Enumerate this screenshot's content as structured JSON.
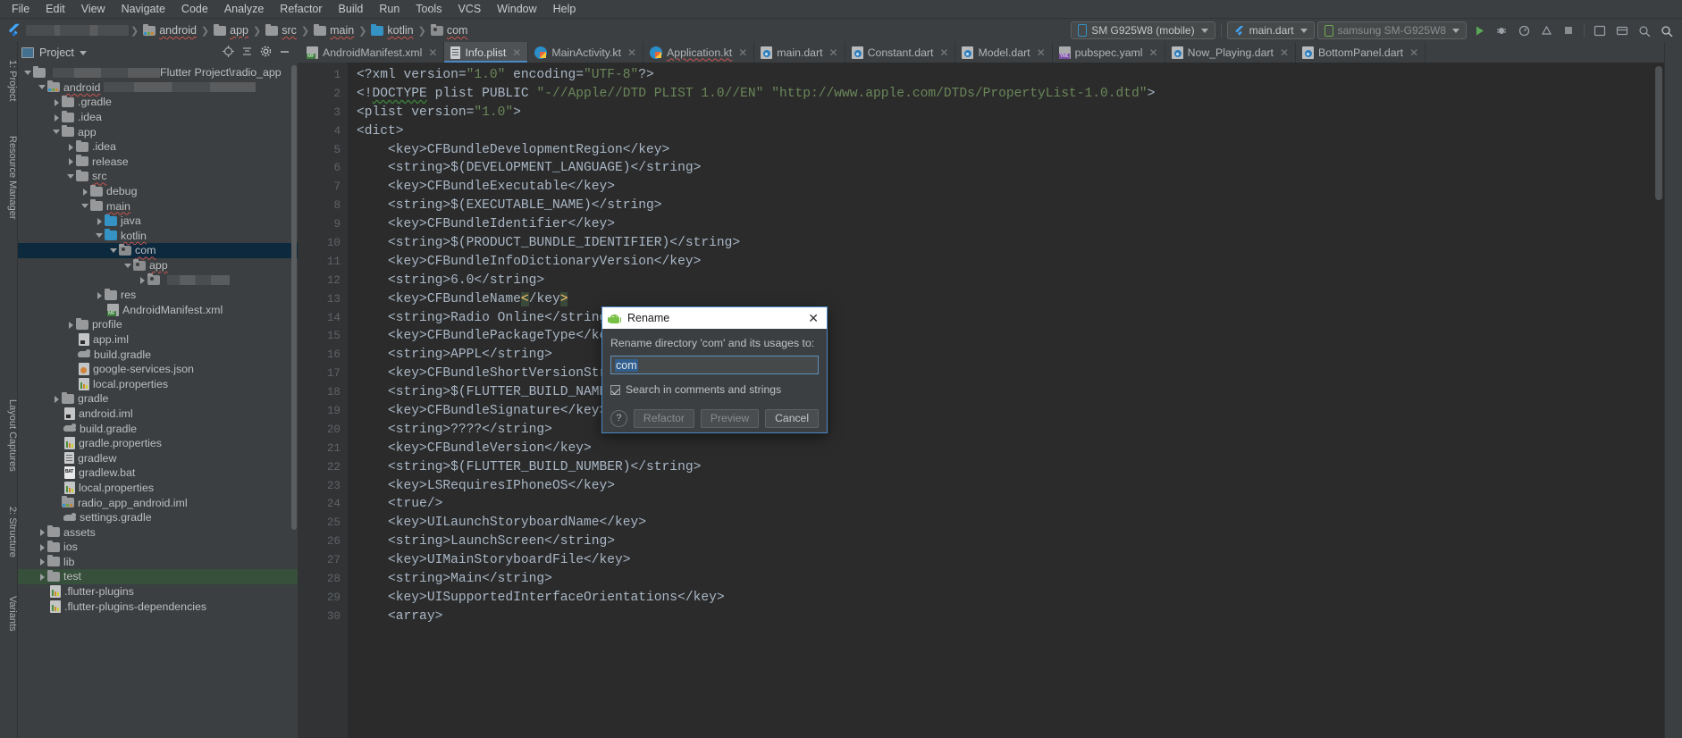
{
  "menu": {
    "items": [
      "File",
      "Edit",
      "View",
      "Navigate",
      "Code",
      "Analyze",
      "Refactor",
      "Build",
      "Run",
      "Tools",
      "VCS",
      "Window",
      "Help"
    ]
  },
  "breadcrumb": {
    "project_redacted": "",
    "items": [
      "android",
      "app",
      "src",
      "main",
      "kotlin",
      "com"
    ]
  },
  "toolbar": {
    "device": "SM G925W8 (mobile)",
    "run_config": "main.dart",
    "device2": "samsung SM-G925W8",
    "icons": [
      "run-icon",
      "debug-icon",
      "profile-icon",
      "attach-debugger-icon",
      "stop-icon",
      "avd-manager-icon",
      "sdk-manager-icon",
      "layout-inspector-icon",
      "sync-gradle-icon",
      "search-everywhere-icon"
    ]
  },
  "project_panel": {
    "title": "Project",
    "header_icons": [
      "locate-icon",
      "collapse-all-icon",
      "settings-icon",
      "hide-icon"
    ],
    "root_suffix": "Flutter Project\\radio_app",
    "tree": [
      {
        "label": "",
        "suffix": "Flutter Project\\radio_app",
        "indent": 0,
        "arrow": "d",
        "icon": "project-folder",
        "redacted": 120
      },
      {
        "label": "android",
        "indent": 1,
        "arrow": "d",
        "icon": "module-folder",
        "spell": true,
        "redacted": 170
      },
      {
        "label": ".gradle",
        "indent": 2,
        "arrow": "r",
        "icon": "folder"
      },
      {
        "label": ".idea",
        "indent": 2,
        "arrow": "r",
        "icon": "folder"
      },
      {
        "label": "app",
        "indent": 2,
        "arrow": "d",
        "icon": "folder"
      },
      {
        "label": ".idea",
        "indent": 3,
        "arrow": "r",
        "icon": "folder"
      },
      {
        "label": "release",
        "indent": 3,
        "arrow": "r",
        "icon": "folder"
      },
      {
        "label": "src",
        "indent": 3,
        "arrow": "d",
        "icon": "folder",
        "spell": true
      },
      {
        "label": "debug",
        "indent": 4,
        "arrow": "r",
        "icon": "folder"
      },
      {
        "label": "main",
        "indent": 4,
        "arrow": "d",
        "icon": "folder",
        "spell": true
      },
      {
        "label": "java",
        "indent": 5,
        "arrow": "r",
        "icon": "source-folder"
      },
      {
        "label": "kotlin",
        "indent": 5,
        "arrow": "d",
        "icon": "source-folder",
        "spell": true
      },
      {
        "label": "com",
        "indent": 6,
        "arrow": "d",
        "icon": "package",
        "selected": true,
        "spell": true
      },
      {
        "label": "app",
        "indent": 7,
        "arrow": "d",
        "icon": "package",
        "spell": true
      },
      {
        "label": "",
        "indent": 8,
        "arrow": "r",
        "icon": "package",
        "redacted": 70
      },
      {
        "label": "res",
        "indent": 5,
        "arrow": "r",
        "icon": "folder"
      },
      {
        "label": "AndroidManifest.xml",
        "indent": 5,
        "arrow": "",
        "icon": "manifest"
      },
      {
        "label": "profile",
        "indent": 3,
        "arrow": "r",
        "icon": "folder"
      },
      {
        "label": "app.iml",
        "indent": 3,
        "arrow": "",
        "icon": "iml"
      },
      {
        "label": "build.gradle",
        "indent": 3,
        "arrow": "",
        "icon": "gradle"
      },
      {
        "label": "google-services.json",
        "indent": 3,
        "arrow": "",
        "icon": "json"
      },
      {
        "label": "local.properties",
        "indent": 3,
        "arrow": "",
        "icon": "properties"
      },
      {
        "label": "gradle",
        "indent": 2,
        "arrow": "r",
        "icon": "folder"
      },
      {
        "label": "android.iml",
        "indent": 2,
        "arrow": "",
        "icon": "iml"
      },
      {
        "label": "build.gradle",
        "indent": 2,
        "arrow": "",
        "icon": "gradle"
      },
      {
        "label": "gradle.properties",
        "indent": 2,
        "arrow": "",
        "icon": "properties"
      },
      {
        "label": "gradlew",
        "indent": 2,
        "arrow": "",
        "icon": "text"
      },
      {
        "label": "gradlew.bat",
        "indent": 2,
        "arrow": "",
        "icon": "bat"
      },
      {
        "label": "local.properties",
        "indent": 2,
        "arrow": "",
        "icon": "properties"
      },
      {
        "label": "radio_app_android.iml",
        "indent": 2,
        "arrow": "",
        "icon": "module-folder"
      },
      {
        "label": "settings.gradle",
        "indent": 2,
        "arrow": "",
        "icon": "gradle"
      },
      {
        "label": "assets",
        "indent": 1,
        "arrow": "r",
        "icon": "folder"
      },
      {
        "label": "ios",
        "indent": 1,
        "arrow": "r",
        "icon": "folder"
      },
      {
        "label": "lib",
        "indent": 1,
        "arrow": "r",
        "icon": "folder"
      },
      {
        "label": "test",
        "indent": 1,
        "arrow": "r",
        "icon": "folder",
        "selected2": true
      },
      {
        "label": ".flutter-plugins",
        "indent": 1,
        "arrow": "",
        "icon": "properties"
      },
      {
        "label": ".flutter-plugins-dependencies",
        "indent": 1,
        "arrow": "",
        "icon": "properties"
      }
    ]
  },
  "left_strip": {
    "labels": [
      "1: Project",
      "Resource Manager",
      "Layout Captures",
      "2: Structure",
      "Variants"
    ]
  },
  "tabs": [
    {
      "label": "AndroidManifest.xml",
      "icon": "manifest",
      "active": false
    },
    {
      "label": "Info.plist",
      "icon": "plist",
      "active": true
    },
    {
      "label": "MainActivity.kt",
      "icon": "kotlin",
      "active": false
    },
    {
      "label": "Application.kt",
      "icon": "kotlin",
      "active": false,
      "spell": true
    },
    {
      "label": "main.dart",
      "icon": "dart",
      "active": false
    },
    {
      "label": "Constant.dart",
      "icon": "dart",
      "active": false
    },
    {
      "label": "Model.dart",
      "icon": "dart",
      "active": false
    },
    {
      "label": "pubspec.yaml",
      "icon": "yaml",
      "active": false
    },
    {
      "label": "Now_Playing.dart",
      "icon": "dart",
      "active": false
    },
    {
      "label": "BottomPanel.dart",
      "icon": "dart",
      "active": false
    }
  ],
  "editor": {
    "first_line": 1,
    "lines": [
      "<?xml version=\"1.0\" encoding=\"UTF-8\"?>",
      "<!DOCTYPE plist PUBLIC \"-//Apple//DTD PLIST 1.0//EN\" \"http://www.apple.com/DTDs/PropertyList-1.0.dtd\">",
      "<plist version=\"1.0\">",
      "<dict>",
      "    <key>CFBundleDevelopmentRegion</key>",
      "    <string>$(DEVELOPMENT_LANGUAGE)</string>",
      "    <key>CFBundleExecutable</key>",
      "    <string>$(EXECUTABLE_NAME)</string>",
      "    <key>CFBundleIdentifier</key>",
      "    <string>$(PRODUCT_BUNDLE_IDENTIFIER)</string>",
      "    <key>CFBundleInfoDictionaryVersion</key>",
      "    <string>6.0</string>",
      "    <key>CFBundleName</key>",
      "    <string>Radio Online</string>",
      "    <key>CFBundlePackageType</key>",
      "    <string>APPL</string>",
      "    <key>CFBundleShortVersionString</key>",
      "    <string>$(FLUTTER_BUILD_NAME)</string>",
      "    <key>CFBundleSignature</key>",
      "    <string>????</string>",
      "    <key>CFBundleVersion</key>",
      "    <string>$(FLUTTER_BUILD_NUMBER)</string>",
      "    <key>LSRequiresIPhoneOS</key>",
      "    <true/>",
      "    <key>UILaunchStoryboardName</key>",
      "    <string>LaunchScreen</string>",
      "    <key>UIMainStoryboardFile</key>",
      "    <string>Main</string>",
      "    <key>UISupportedInterfaceOrientations</key>",
      "    <array>"
    ]
  },
  "rename_dialog": {
    "title": "Rename",
    "icon": "android-icon",
    "close_label": "✕",
    "message": "Rename directory 'com' and its usages to:",
    "input_value": "com",
    "checkbox_label": "Search in comments and strings",
    "checkbox_checked": true,
    "help_label": "?",
    "buttons": {
      "refactor": "Refactor",
      "preview": "Preview",
      "cancel": "Cancel"
    }
  }
}
